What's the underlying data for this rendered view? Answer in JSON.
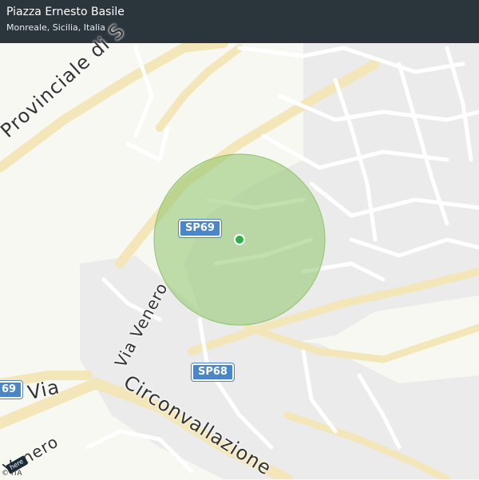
{
  "header": {
    "title": "Piazza Ernesto Basile",
    "subtitle": "Monreale, Sicilia, Italia"
  },
  "map": {
    "colors": {
      "background": "#f7f8f2",
      "urban": "#ebebeb",
      "road_major": "#f3e6b8",
      "road_minor": "#ffffff",
      "radius": "#8fc46b",
      "marker": "#2bb04a",
      "shield": "#4a86c8"
    },
    "road_shields": [
      "SP69",
      "SP68",
      "69"
    ],
    "street_labels": {
      "provinciale": "Provinciale di S",
      "via_venero_1": "Via Venero",
      "via": "Via",
      "circonvallazione": "Circonvallazione",
      "venero_2": "Venero"
    },
    "attribution": "© ITA",
    "logo_text": "here"
  }
}
